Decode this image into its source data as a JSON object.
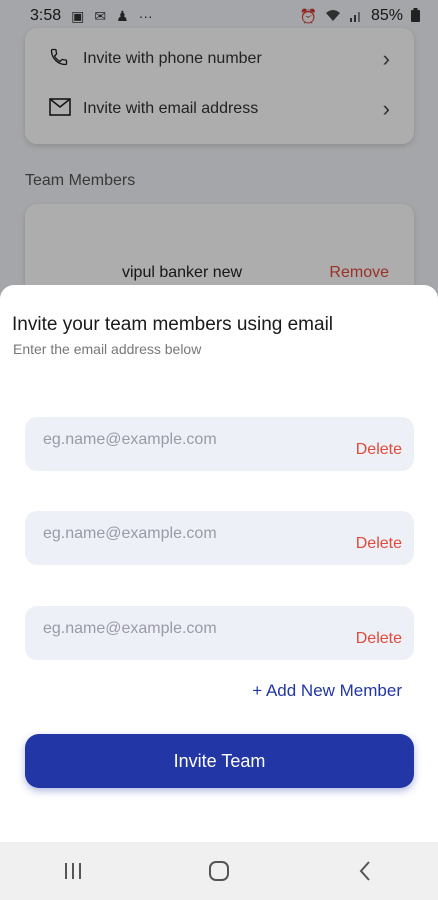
{
  "status_bar": {
    "time": "3:58",
    "battery": "85%"
  },
  "background": {
    "invite_options": [
      {
        "label": "Invite with phone number",
        "icon": "phone-icon"
      },
      {
        "label": "Invite with email address",
        "icon": "envelope-icon"
      }
    ],
    "section_label": "Team Members",
    "member": {
      "name": "vipul banker new",
      "remove_label": "Remove"
    }
  },
  "sheet": {
    "title": "Invite your team members using email",
    "subtitle": "Enter the email address below",
    "email_rows": [
      {
        "placeholder": "eg.name@example.com",
        "value": "",
        "delete_label": "Delete"
      },
      {
        "placeholder": "eg.name@example.com",
        "value": "",
        "delete_label": "Delete"
      },
      {
        "placeholder": "eg.name@example.com",
        "value": "",
        "delete_label": "Delete"
      }
    ],
    "add_member_label": "+ Add New Member",
    "invite_button_label": "Invite Team"
  },
  "colors": {
    "accent": "#2236a6",
    "danger": "#e04a3a",
    "input_bg": "#eef0f8"
  },
  "nav_bar": {
    "buttons": [
      "recent-apps-icon",
      "home-icon",
      "back-icon"
    ]
  }
}
